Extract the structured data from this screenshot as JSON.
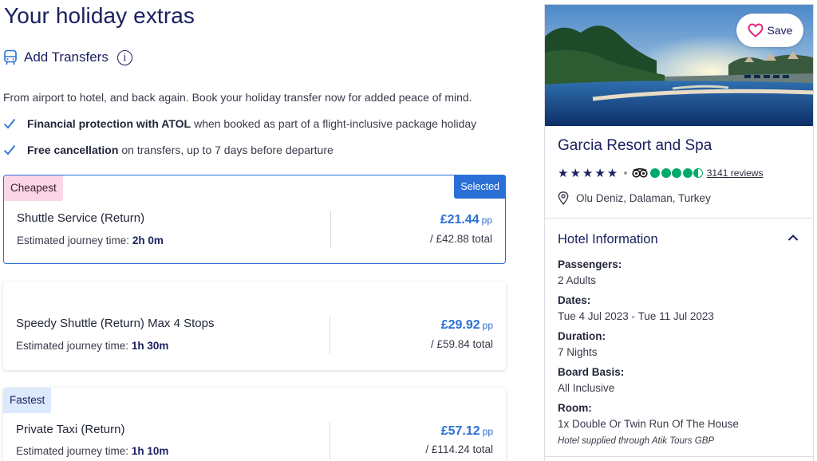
{
  "page_title": "Your holiday extras",
  "transfers": {
    "heading": "Add Transfers",
    "info_symbol": "i",
    "intro": "From airport to hotel, and back again. Book your holiday transfer now for added peace of mind.",
    "benefits": [
      {
        "bold": "Financial protection with ATOL",
        "text": "when booked as part of a flight-inclusive package holiday"
      },
      {
        "bold": "Free cancellation",
        "text": "on transfers, up to 7 days before departure"
      }
    ],
    "journey_prefix": "Estimated journey time:",
    "pp_label": "pp",
    "options": [
      {
        "tag": "Cheapest",
        "selected_label": "Selected",
        "name": "Shuttle Service (Return)",
        "journey_time": "2h 0m",
        "price_pp": "£21.44",
        "total": "/ £42.88 total"
      },
      {
        "tag": "",
        "name": "Speedy Shuttle (Return) Max 4 Stops",
        "journey_time": "1h 30m",
        "price_pp": "£29.92",
        "total": "/ £59.84 total"
      },
      {
        "tag": "Fastest",
        "name": "Private Taxi (Return)",
        "journey_time": "1h 10m",
        "price_pp": "£57.12",
        "total": "/ £114.24 total"
      }
    ]
  },
  "hotel": {
    "save_label": "Save",
    "name": "Garcia Resort and Spa",
    "stars": "★★★★★",
    "star_count": 5,
    "tripadvisor_rating": 4.5,
    "reviews": "3141 reviews",
    "location": "Olu Deniz, Dalaman, Turkey",
    "info_title": "Hotel Information",
    "details": [
      {
        "label": "Passengers:",
        "value": "2 Adults"
      },
      {
        "label": "Dates:",
        "value": "Tue 4 Jul 2023 - Tue 11 Jul 2023"
      },
      {
        "label": "Duration:",
        "value": "7 Nights"
      },
      {
        "label": "Board Basis:",
        "value": "All Inclusive"
      },
      {
        "label": "Room:",
        "value": "1x Double Or Twin Run Of The House"
      }
    ],
    "supplied_by": "Hotel supplied through Atik Tours GBP"
  },
  "colors": {
    "brand_navy": "#1b2060",
    "accent_blue": "#2a6fd6",
    "tag_pink": "#fbd6e6",
    "tag_blue": "#dce8fb",
    "tripadvisor_green": "#00aa6c",
    "save_heart": "#e0287c"
  }
}
